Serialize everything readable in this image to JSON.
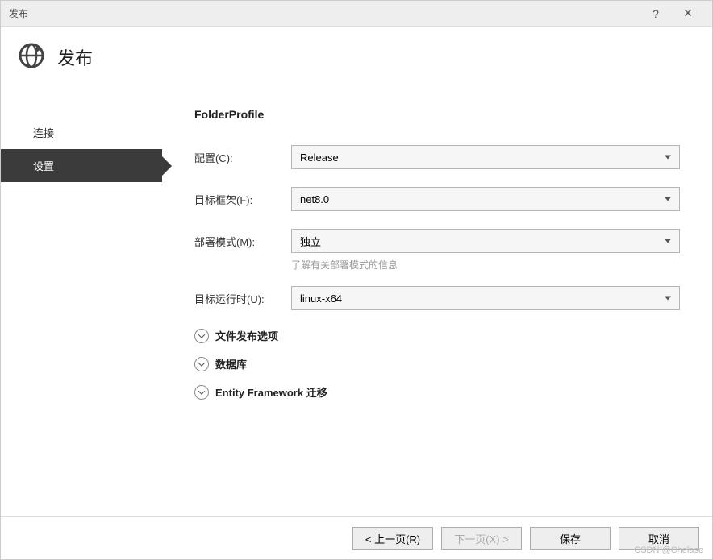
{
  "window": {
    "title": "发布",
    "help_label": "?",
    "close_label": "✕"
  },
  "header": {
    "title": "发布"
  },
  "sidebar": {
    "items": [
      {
        "label": "连接",
        "active": false
      },
      {
        "label": "设置",
        "active": true
      }
    ]
  },
  "main": {
    "profile_title": "FolderProfile",
    "fields": {
      "configuration": {
        "label": "配置(C):",
        "value": "Release"
      },
      "target_framework": {
        "label": "目标框架(F):",
        "value": "net8.0"
      },
      "deployment_mode": {
        "label": "部署模式(M):",
        "value": "独立",
        "hint": "了解有关部署模式的信息"
      },
      "target_runtime": {
        "label": "目标运行时(U):",
        "value": "linux-x64"
      }
    },
    "expanders": [
      {
        "label": "文件发布选项"
      },
      {
        "label": "数据库"
      },
      {
        "label": "Entity Framework 迁移"
      }
    ]
  },
  "footer": {
    "prev": "< 上一页(R)",
    "next": "下一页(X) >",
    "save": "保存",
    "cancel": "取消"
  },
  "watermark": "CSDN @Chelase"
}
